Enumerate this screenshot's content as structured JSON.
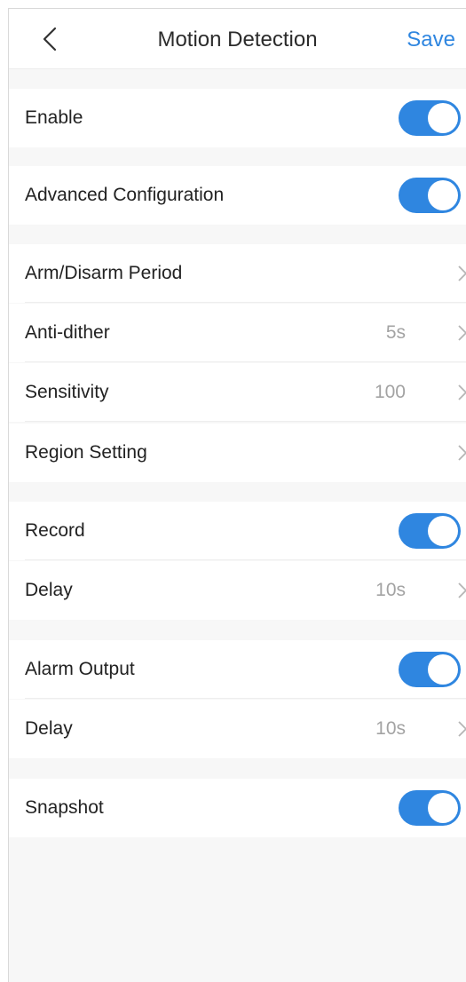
{
  "header": {
    "title": "Motion Detection",
    "save_label": "Save",
    "back_icon": "chevron-left-icon"
  },
  "colors": {
    "accent": "#2f86e0",
    "background": "#f7f7f7",
    "value_text": "#a3a3a3"
  },
  "settings": {
    "enable": {
      "label": "Enable",
      "on": true
    },
    "advanced": {
      "label": "Advanced Configuration",
      "on": true
    },
    "arm_period": {
      "label": "Arm/Disarm Period"
    },
    "anti_dither": {
      "label": "Anti-dither",
      "value": "5s"
    },
    "sensitivity": {
      "label": "Sensitivity",
      "value": "100"
    },
    "region": {
      "label": "Region Setting"
    },
    "record": {
      "label": "Record",
      "on": true
    },
    "record_delay": {
      "label": "Delay",
      "value": "10s"
    },
    "alarm_output": {
      "label": "Alarm Output",
      "on": true
    },
    "alarm_delay": {
      "label": "Delay",
      "value": "10s"
    },
    "snapshot": {
      "label": "Snapshot",
      "on": true
    }
  }
}
